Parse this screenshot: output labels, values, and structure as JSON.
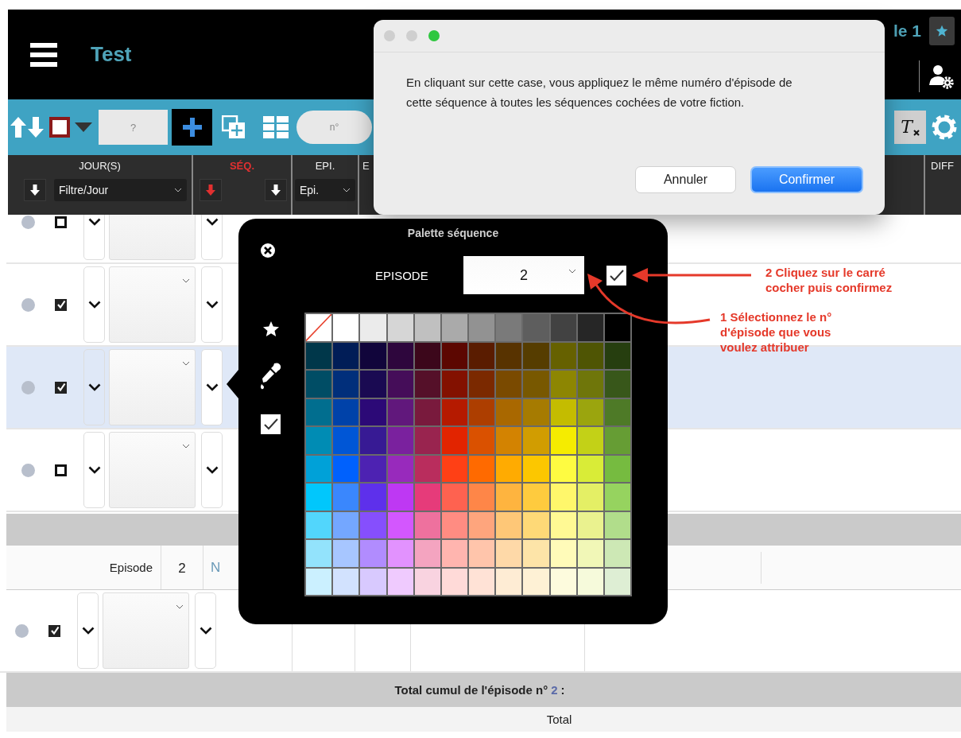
{
  "header": {
    "title": "Test",
    "account_label": "le 1"
  },
  "toolbar": {
    "select_all_checked": false,
    "search_placeholder": "?",
    "number_placeholder": "n°",
    "clear_format_label": "T"
  },
  "columns": [
    {
      "label": "JOUR(S)",
      "kind": "jour",
      "filter": "Filtre/Jour"
    },
    {
      "label": "SÉQ.",
      "kind": "seq"
    },
    {
      "label": "EPI.",
      "kind": "epi",
      "filter": "Epi."
    },
    {
      "label": "E",
      "kind": "plain"
    },
    {
      "label": "DIFF",
      "kind": "edge"
    }
  ],
  "rows": [
    {
      "checked": false,
      "selected": false
    },
    {
      "checked": true,
      "selected": false
    },
    {
      "checked": true,
      "selected": true
    },
    {
      "checked": false,
      "selected": false
    }
  ],
  "episode_group": {
    "label": "Episode",
    "number": "2",
    "column_3": "N",
    "rows": [
      {
        "checked": true,
        "selected": false
      }
    ]
  },
  "total_cumul": {
    "label": "Total cumul de l'épisode n°",
    "episode": "2",
    "suffix": ":"
  },
  "total": {
    "label": "Total"
  },
  "palette": {
    "title": "Palette séquence",
    "episode_label": "EPISODE",
    "episode_value": "2",
    "apply_checked": true,
    "swatch_rows": [
      [
        {
          "kind": "none"
        },
        {
          "kind": "color",
          "color": "#ffffff"
        },
        {
          "kind": "color",
          "color": "#ebebeb"
        },
        {
          "kind": "color",
          "color": "#d6d6d6"
        },
        {
          "kind": "color",
          "color": "#c0c0c0"
        },
        {
          "kind": "color",
          "color": "#aaaaaa"
        },
        {
          "kind": "color",
          "color": "#929292"
        },
        {
          "kind": "color",
          "color": "#7a7a7a"
        },
        {
          "kind": "color",
          "color": "#5e5e5e"
        },
        {
          "kind": "color",
          "color": "#424242"
        },
        {
          "kind": "color",
          "color": "#262626"
        },
        {
          "kind": "color",
          "color": "#000000"
        }
      ],
      [
        {
          "kind": "color",
          "color": "#00374a"
        },
        {
          "kind": "color",
          "color": "#011d57"
        },
        {
          "kind": "color",
          "color": "#11053b"
        },
        {
          "kind": "color",
          "color": "#2e063d"
        },
        {
          "kind": "color",
          "color": "#3c071b"
        },
        {
          "kind": "color",
          "color": "#5c0701"
        },
        {
          "kind": "color",
          "color": "#5a1c00"
        },
        {
          "kind": "color",
          "color": "#583300"
        },
        {
          "kind": "color",
          "color": "#563d00"
        },
        {
          "kind": "color",
          "color": "#666100"
        },
        {
          "kind": "color",
          "color": "#4f5504"
        },
        {
          "kind": "color",
          "color": "#263e0f"
        }
      ],
      [
        {
          "kind": "color",
          "color": "#004d65"
        },
        {
          "kind": "color",
          "color": "#012f7b"
        },
        {
          "kind": "color",
          "color": "#1a0a52"
        },
        {
          "kind": "color",
          "color": "#450d59"
        },
        {
          "kind": "color",
          "color": "#551029"
        },
        {
          "kind": "color",
          "color": "#831100"
        },
        {
          "kind": "color",
          "color": "#7b2900"
        },
        {
          "kind": "color",
          "color": "#7a4a00"
        },
        {
          "kind": "color",
          "color": "#785800"
        },
        {
          "kind": "color",
          "color": "#8d8602"
        },
        {
          "kind": "color",
          "color": "#6f760a"
        },
        {
          "kind": "color",
          "color": "#38571a"
        }
      ],
      [
        {
          "kind": "color",
          "color": "#016e8f"
        },
        {
          "kind": "color",
          "color": "#0042a9"
        },
        {
          "kind": "color",
          "color": "#2c0977"
        },
        {
          "kind": "color",
          "color": "#61187c"
        },
        {
          "kind": "color",
          "color": "#791a3d"
        },
        {
          "kind": "color",
          "color": "#b51a00"
        },
        {
          "kind": "color",
          "color": "#ad3e00"
        },
        {
          "kind": "color",
          "color": "#a96800"
        },
        {
          "kind": "color",
          "color": "#a67b01"
        },
        {
          "kind": "color",
          "color": "#c4bc00"
        },
        {
          "kind": "color",
          "color": "#9ba50e"
        },
        {
          "kind": "color",
          "color": "#4e7a27"
        }
      ],
      [
        {
          "kind": "color",
          "color": "#008cb4"
        },
        {
          "kind": "color",
          "color": "#0056d6"
        },
        {
          "kind": "color",
          "color": "#371a94"
        },
        {
          "kind": "color",
          "color": "#7a219e"
        },
        {
          "kind": "color",
          "color": "#99244f"
        },
        {
          "kind": "color",
          "color": "#e22400"
        },
        {
          "kind": "color",
          "color": "#da5100"
        },
        {
          "kind": "color",
          "color": "#d38301"
        },
        {
          "kind": "color",
          "color": "#d19d01"
        },
        {
          "kind": "color",
          "color": "#f5ec00"
        },
        {
          "kind": "color",
          "color": "#c3d117"
        },
        {
          "kind": "color",
          "color": "#669d34"
        }
      ],
      [
        {
          "kind": "color",
          "color": "#00a1d8"
        },
        {
          "kind": "color",
          "color": "#0061fd"
        },
        {
          "kind": "color",
          "color": "#4d22b2"
        },
        {
          "kind": "color",
          "color": "#982abc"
        },
        {
          "kind": "color",
          "color": "#b92d5d"
        },
        {
          "kind": "color",
          "color": "#ff4015"
        },
        {
          "kind": "color",
          "color": "#ff6a00"
        },
        {
          "kind": "color",
          "color": "#ffab01"
        },
        {
          "kind": "color",
          "color": "#fcc700"
        },
        {
          "kind": "color",
          "color": "#fefb41"
        },
        {
          "kind": "color",
          "color": "#d9ec37"
        },
        {
          "kind": "color",
          "color": "#76bb40"
        }
      ],
      [
        {
          "kind": "color",
          "color": "#01c7fc"
        },
        {
          "kind": "color",
          "color": "#3a87fd"
        },
        {
          "kind": "color",
          "color": "#5e30eb"
        },
        {
          "kind": "color",
          "color": "#be38f3"
        },
        {
          "kind": "color",
          "color": "#e63b7a"
        },
        {
          "kind": "color",
          "color": "#fe6250"
        },
        {
          "kind": "color",
          "color": "#fe8648"
        },
        {
          "kind": "color",
          "color": "#feb43f"
        },
        {
          "kind": "color",
          "color": "#fecb3e"
        },
        {
          "kind": "color",
          "color": "#fff76b"
        },
        {
          "kind": "color",
          "color": "#e4ef65"
        },
        {
          "kind": "color",
          "color": "#96d35f"
        }
      ],
      [
        {
          "kind": "color",
          "color": "#52d6fc"
        },
        {
          "kind": "color",
          "color": "#74a7ff"
        },
        {
          "kind": "color",
          "color": "#864ffd"
        },
        {
          "kind": "color",
          "color": "#d357fe"
        },
        {
          "kind": "color",
          "color": "#ee719e"
        },
        {
          "kind": "color",
          "color": "#ff8c82"
        },
        {
          "kind": "color",
          "color": "#fea57d"
        },
        {
          "kind": "color",
          "color": "#fec777"
        },
        {
          "kind": "color",
          "color": "#fed977"
        },
        {
          "kind": "color",
          "color": "#fff994"
        },
        {
          "kind": "color",
          "color": "#eaf28f"
        },
        {
          "kind": "color",
          "color": "#b1dd8b"
        }
      ],
      [
        {
          "kind": "color",
          "color": "#93e3fc"
        },
        {
          "kind": "color",
          "color": "#a7c6ff"
        },
        {
          "kind": "color",
          "color": "#b18cfe"
        },
        {
          "kind": "color",
          "color": "#e292fe"
        },
        {
          "kind": "color",
          "color": "#f4a4c0"
        },
        {
          "kind": "color",
          "color": "#ffb5af"
        },
        {
          "kind": "color",
          "color": "#ffc5ab"
        },
        {
          "kind": "color",
          "color": "#fed9a8"
        },
        {
          "kind": "color",
          "color": "#fde4a8"
        },
        {
          "kind": "color",
          "color": "#fffbb9"
        },
        {
          "kind": "color",
          "color": "#f1f7b7"
        },
        {
          "kind": "color",
          "color": "#cde8b5"
        }
      ],
      [
        {
          "kind": "color",
          "color": "#cbf0ff"
        },
        {
          "kind": "color",
          "color": "#d2e2fe"
        },
        {
          "kind": "color",
          "color": "#d8c9fe"
        },
        {
          "kind": "color",
          "color": "#efcafe"
        },
        {
          "kind": "color",
          "color": "#f9d3e0"
        },
        {
          "kind": "color",
          "color": "#ffdad8"
        },
        {
          "kind": "color",
          "color": "#ffe2d6"
        },
        {
          "kind": "color",
          "color": "#feecd4"
        },
        {
          "kind": "color",
          "color": "#fef1d5"
        },
        {
          "kind": "color",
          "color": "#fdfbdd"
        },
        {
          "kind": "color",
          "color": "#f6fadb"
        },
        {
          "kind": "color",
          "color": "#deeed4"
        }
      ]
    ]
  },
  "dialog": {
    "message": "En cliquant sur cette case, vous appliquez le même numéro d'épisode de cette séquence à toutes les séquences cochées de votre fiction.",
    "buttons": [
      {
        "label": "Annuler",
        "kind": "cancel"
      },
      {
        "label": "Confirmer",
        "kind": "default"
      }
    ]
  },
  "annotations": [
    {
      "text": "2 Cliquez sur le carré\ncocher puis confirmez"
    },
    {
      "text": "1 Sélectionnez le n°\nd'épisode que vous\nvoulez attribuer"
    }
  ]
}
